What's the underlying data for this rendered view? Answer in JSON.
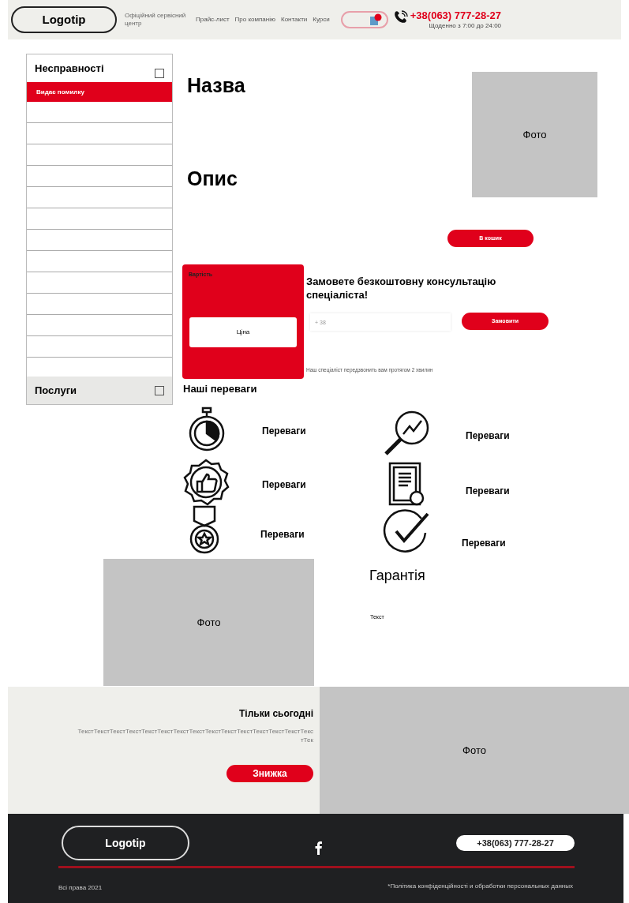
{
  "header": {
    "logo": "Logotip",
    "tagline": "Офіційний сервісний центр",
    "nav": [
      {
        "label": "Прайс-лист"
      },
      {
        "label": "Про компанію"
      },
      {
        "label": "Контакти"
      },
      {
        "label": "Курси"
      }
    ],
    "phone": "+38(063) 777-28-27",
    "hours": "Щоденно з 7:00 до 24:00",
    "language_switch": {
      "on": true
    }
  },
  "sidebar": {
    "sections": [
      {
        "title": "Несправності",
        "expanded": true,
        "items": [
          {
            "label": "Видає помилку",
            "selected": true
          }
        ]
      },
      {
        "title": "Послуги",
        "expanded": false
      }
    ]
  },
  "product": {
    "title": "Назва",
    "description": "Опис",
    "photo": "Фото",
    "cart_button": "В кошик"
  },
  "price_card": {
    "label": "Вартість",
    "price": "Ціна"
  },
  "consultation": {
    "heading": "Замовете безкоштовну консультацію спеціаліста!",
    "placeholder": "+ 38",
    "button": "Замовити",
    "note": "Наш спеціаліст передзвонить вам протягом 2 хвилин"
  },
  "advantages": {
    "heading": "Наші переваги",
    "items": [
      {
        "kind": "stopwatch",
        "label": "Переваги"
      },
      {
        "kind": "analytics",
        "label": "Переваги"
      },
      {
        "kind": "like",
        "label": "Переваги"
      },
      {
        "kind": "certificate",
        "label": "Переваги"
      },
      {
        "kind": "medal",
        "label": "Переваги"
      },
      {
        "kind": "check",
        "label": "Переваги"
      }
    ]
  },
  "guarantee": {
    "photo": "Фото",
    "title": "Гарантія",
    "text": "Текст"
  },
  "promo": {
    "title": "Тільки сьогодні",
    "text": "ТекстТекстТекстТекстТекстТекстТекстТекстТекстТекстТекстТекстТекстТекстТекстТек",
    "button": "Знижка",
    "photo": "Фото"
  },
  "footer": {
    "logo": "Logotip",
    "phone": "+38(063) 777-28-27",
    "copyright": "Всі права 2021",
    "policy": "*Політика конфіденційності и обработки персональных данных"
  }
}
